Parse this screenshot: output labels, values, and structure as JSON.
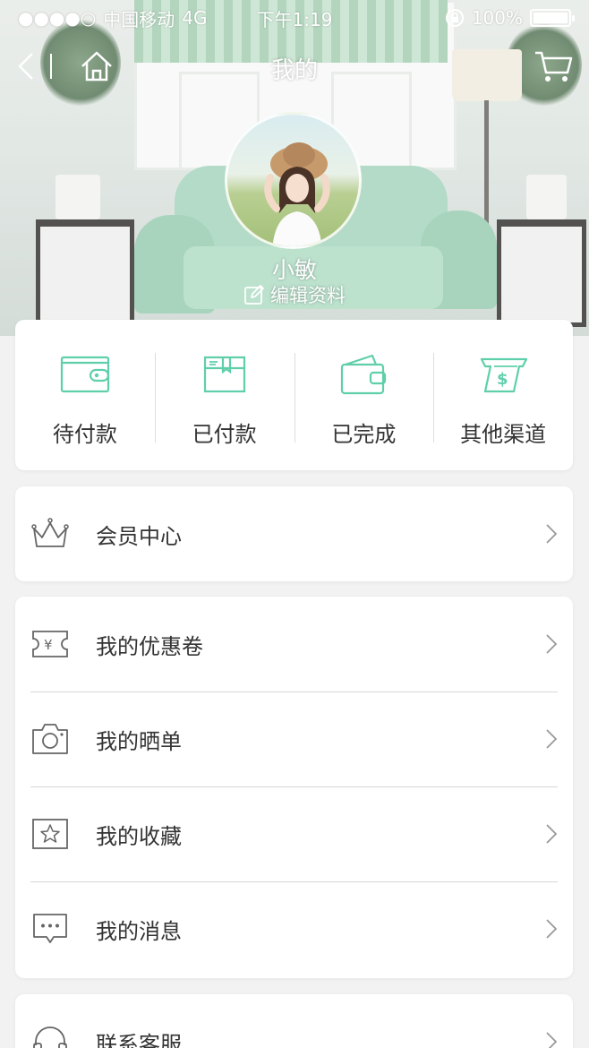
{
  "status_bar": {
    "carrier": "中国移动",
    "network": "4G",
    "time": "下午1:19",
    "battery": "100%"
  },
  "nav": {
    "title": "我的"
  },
  "profile": {
    "username": "小敏",
    "edit_label": "编辑资料"
  },
  "orders": [
    {
      "label": "待付款",
      "icon": "wallet-icon"
    },
    {
      "label": "已付款",
      "icon": "box-icon"
    },
    {
      "label": "已完成",
      "icon": "purse-icon"
    },
    {
      "label": "其他渠道",
      "icon": "money-icon"
    }
  ],
  "vip": {
    "label": "会员中心",
    "icon": "crown-icon"
  },
  "menu": [
    {
      "label": "我的优惠卷",
      "icon": "coupon-icon"
    },
    {
      "label": "我的晒单",
      "icon": "camera-icon"
    },
    {
      "label": "我的收藏",
      "icon": "star-icon"
    },
    {
      "label": "我的消息",
      "icon": "message-icon"
    }
  ],
  "service": {
    "label": "联系客服",
    "icon": "headset-icon"
  },
  "colors": {
    "accent": "#5fcfab",
    "icon_gray": "#666666",
    "background": "#f2f2f2"
  }
}
